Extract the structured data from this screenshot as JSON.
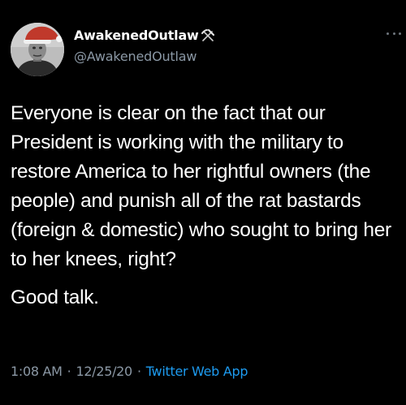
{
  "tweet": {
    "display_name": "AwakenedOutlaw",
    "name_emoji": "hammer-and-pick-icon",
    "handle": "@AwakenedOutlaw",
    "paragraphs": [
      "Everyone is clear on the fact that our President is working with the military to restore America to her rightful owners (the people) and punish all of the rat bastards (foreign & domestic) who sought to bring her to her knees, right?",
      "Good talk."
    ],
    "time": "1:08 AM",
    "separator": "·",
    "date": "12/25/20",
    "source_app": "Twitter Web App",
    "avatar_icon": "santa-hat-avatar-icon",
    "more_icon": "more-options-icon"
  },
  "colors": {
    "background": "#000000",
    "primary_text": "#ffffff",
    "secondary_text": "#8b98a5",
    "link": "#1d9bf0"
  }
}
